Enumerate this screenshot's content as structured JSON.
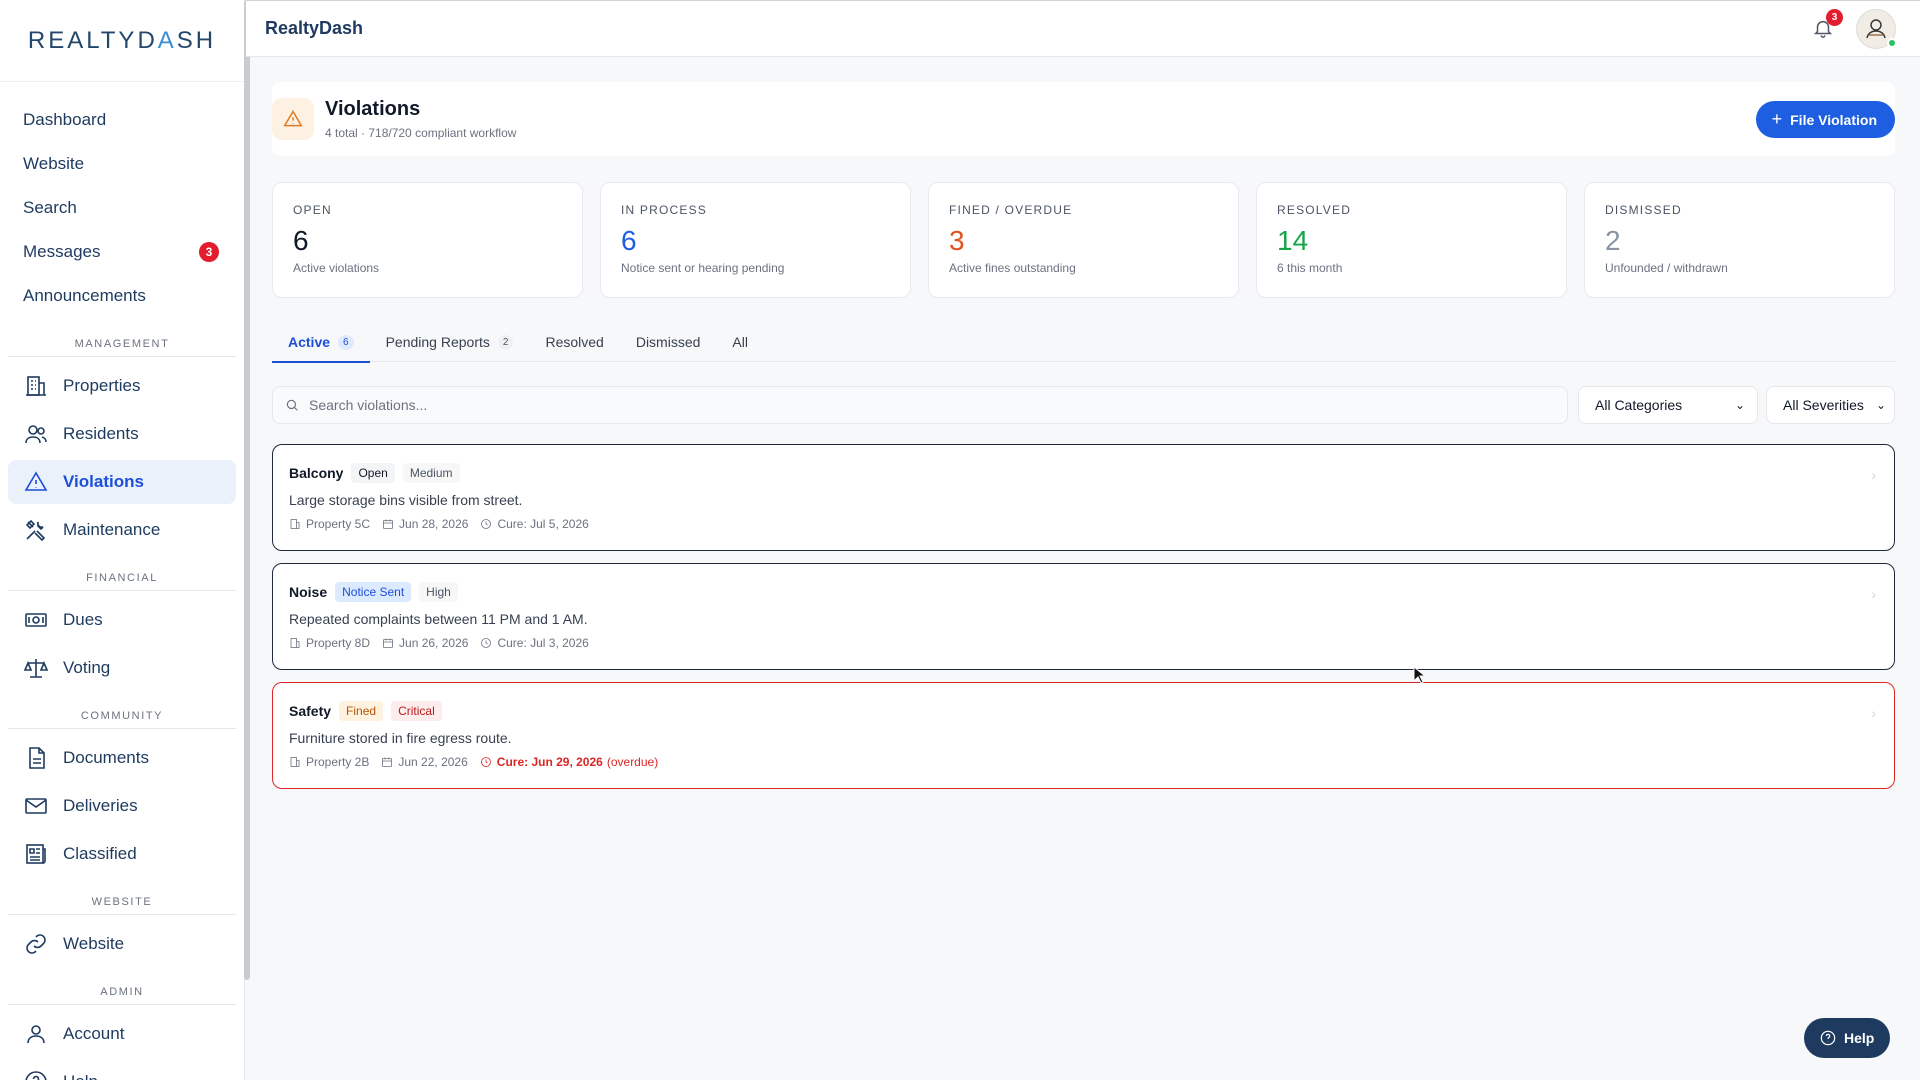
{
  "sidebar": {
    "logo_left": "REALTYD",
    "logo_accent": "A",
    "logo_right": "SH",
    "top_links": [
      {
        "label": "Dashboard"
      },
      {
        "label": "Website"
      },
      {
        "label": "Search"
      },
      {
        "label": "Messages",
        "badge": "3"
      },
      {
        "label": "Announcements"
      }
    ],
    "sections": {
      "management": "MANAGEMENT",
      "financial": "FINANCIAL",
      "community": "COMMUNITY",
      "website": "WEBSITE",
      "admin": "ADMIN"
    },
    "management_items": [
      {
        "label": "Properties",
        "icon": "building-icon"
      },
      {
        "label": "Residents",
        "icon": "users-icon"
      },
      {
        "label": "Violations",
        "icon": "warning-icon",
        "active": true
      },
      {
        "label": "Maintenance",
        "icon": "tools-icon"
      }
    ],
    "financial_items": [
      {
        "label": "Dues",
        "icon": "money-icon"
      },
      {
        "label": "Voting",
        "icon": "scale-icon"
      }
    ],
    "community_items": [
      {
        "label": "Documents",
        "icon": "document-icon"
      },
      {
        "label": "Deliveries",
        "icon": "mail-icon"
      },
      {
        "label": "Classified",
        "icon": "newspaper-icon"
      }
    ],
    "website_items": [
      {
        "label": "Website",
        "icon": "link-icon"
      }
    ],
    "admin_items": [
      {
        "label": "Account",
        "icon": "user-icon"
      },
      {
        "label": "Help",
        "icon": "help-circle-icon"
      }
    ]
  },
  "topbar": {
    "title": "RealtyDash",
    "notifications": "3"
  },
  "page": {
    "title": "Violations",
    "subtitle": "4 total · 718/720 compliant workflow",
    "file_button": "File Violation",
    "file_button_plus": "+"
  },
  "stats": [
    {
      "label": "OPEN",
      "value": "6",
      "desc": "Active violations",
      "color": "#111827"
    },
    {
      "label": "IN PROCESS",
      "value": "6",
      "desc": "Notice sent or hearing pending",
      "color": "#1d5fe0"
    },
    {
      "label": "FINED / OVERDUE",
      "value": "3",
      "desc": "Active fines outstanding",
      "color": "#e0531f"
    },
    {
      "label": "RESOLVED",
      "value": "14",
      "desc": "6 this month",
      "color": "#16a34a"
    },
    {
      "label": "DISMISSED",
      "value": "2",
      "desc": "Unfounded / withdrawn",
      "color": "#8b95a1"
    }
  ],
  "tabs": [
    {
      "label": "Active",
      "count": "6",
      "active": true
    },
    {
      "label": "Pending Reports",
      "count": "2"
    },
    {
      "label": "Resolved"
    },
    {
      "label": "Dismissed"
    },
    {
      "label": "All"
    }
  ],
  "filters": {
    "search_placeholder": "Search violations...",
    "category": "All Categories",
    "severity": "All Severities"
  },
  "violations": [
    {
      "category": "Balcony",
      "status": "Open",
      "severity": "Medium",
      "description": "Large storage bins visible from street.",
      "property": "Property 5C",
      "date": "Jun 28, 2026",
      "cure": "Cure: Jul 5, 2026"
    },
    {
      "category": "Noise",
      "status": "Notice Sent",
      "severity": "High",
      "description": "Repeated complaints between 11 PM and 1 AM.",
      "property": "Property 8D",
      "date": "Jun 26, 2026",
      "cure": "Cure: Jul 3, 2026"
    },
    {
      "category": "Safety",
      "status": "Fined",
      "severity": "Critical",
      "description": "Furniture stored in fire egress route.",
      "property": "Property 2B",
      "date": "Jun 22, 2026",
      "cure": "Cure: Jun 29, 2026",
      "overdue": "(overdue)"
    }
  ],
  "help_button": "Help",
  "colors": {
    "accent": "#1d5fe0",
    "danger": "#dc2626",
    "navy": "#1e3a5f"
  }
}
